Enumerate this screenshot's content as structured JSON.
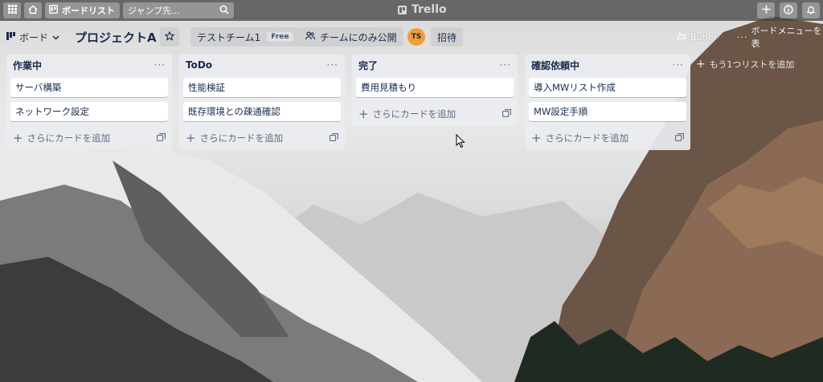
{
  "topbar": {
    "boards_label": "ボードリスト",
    "search_placeholder": "ジャンプ先...",
    "brand": "Trello"
  },
  "board": {
    "switcher_label": "ボード",
    "title": "プロジェクトA",
    "team_name": "テストチーム1",
    "team_plan": "Free",
    "visibility_label": "チームにのみ公開",
    "avatar_initials": "TS",
    "invite_label": "招待",
    "butler_label": "Butler",
    "menu_label": "ボードメニューを表"
  },
  "lists": [
    {
      "title": "作業中",
      "cards": [
        "サーバ構築",
        "ネットワーク設定"
      ],
      "add_label": "さらにカードを追加"
    },
    {
      "title": "ToDo",
      "cards": [
        "性能検証",
        "既存環境との疎通確認"
      ],
      "add_label": "さらにカードを追加"
    },
    {
      "title": "完了",
      "cards": [
        "費用見積もり"
      ],
      "add_label": "さらにカードを追加"
    },
    {
      "title": "確認依頼中",
      "cards": [
        "導入MWリスト作成",
        "MW設定手順"
      ],
      "add_label": "さらにカードを追加"
    }
  ],
  "add_list_label": "もう1つリストを追加",
  "icons": {
    "apps": "grid-icon",
    "home": "home-icon",
    "boards": "board-icon",
    "search": "search-icon",
    "add": "plus-icon",
    "info": "info-icon",
    "notifications": "bell-icon",
    "star": "star-icon",
    "visibility": "team-icon",
    "card_template": "template-icon"
  }
}
